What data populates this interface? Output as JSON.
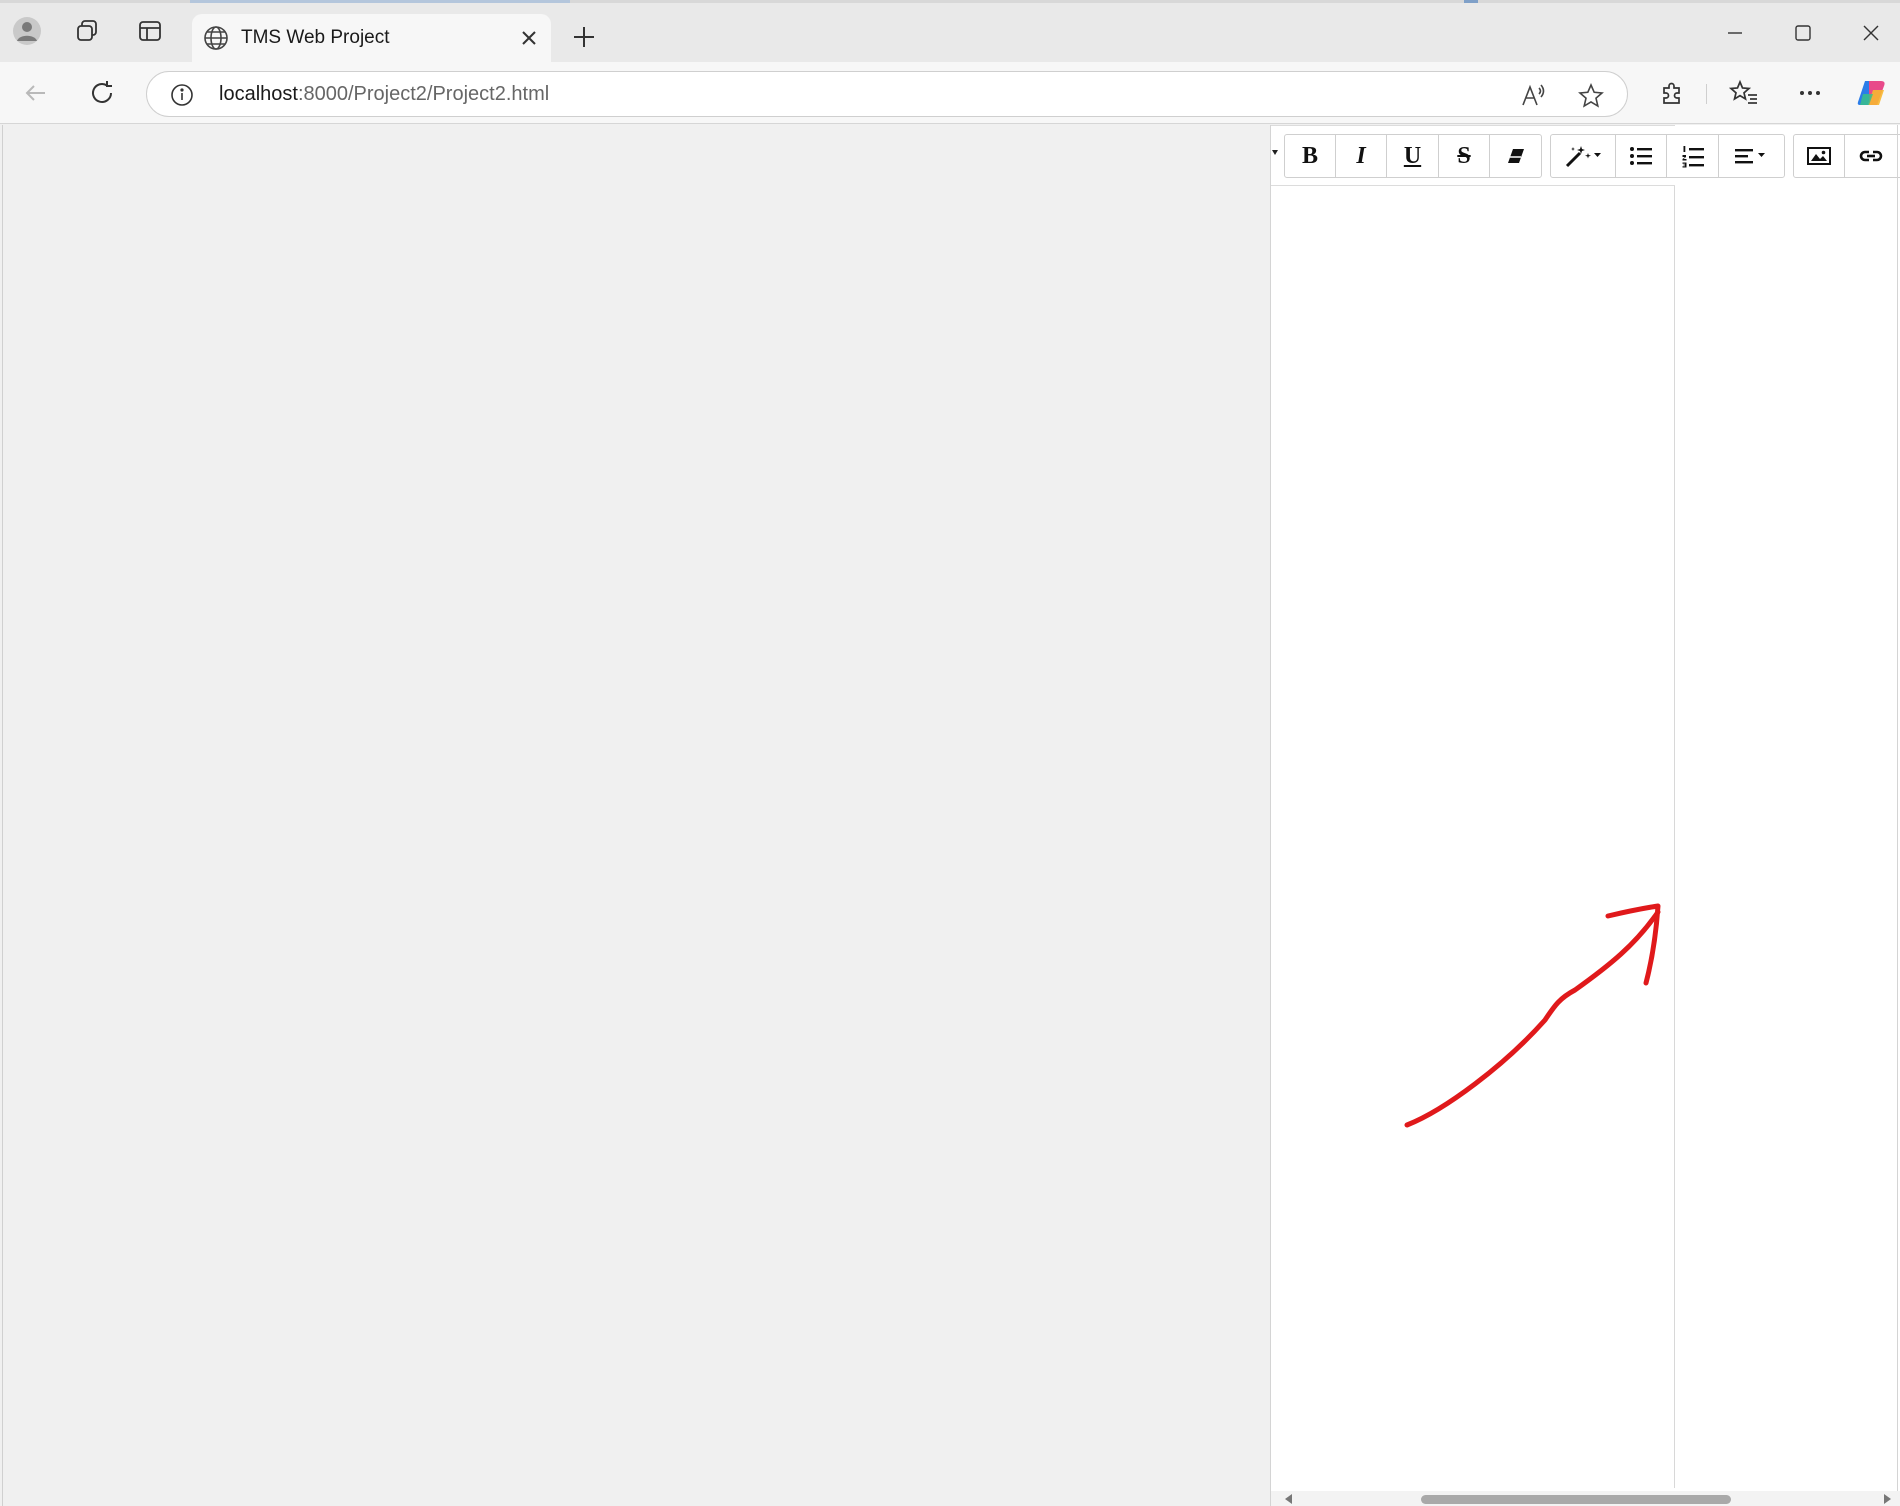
{
  "browser": {
    "tab_title": "TMS Web Project",
    "url_host": "localhost",
    "url_rest": ":8000/Project2/Project2.html",
    "read_aloud_label": "A⁾"
  },
  "toolbar": {
    "bold_label": "B",
    "italic_label": "I",
    "underline_label": "U",
    "strike_label": "S"
  },
  "colors": {
    "annotation_arrow": "#e0191b",
    "accent": "#0b57d0"
  },
  "icons": [
    "profile-icon",
    "workspaces-icon",
    "vertical-tabs-icon",
    "globe-icon",
    "close-icon",
    "plus-icon",
    "minimize-icon",
    "maximize-icon",
    "back-icon",
    "refresh-icon",
    "info-icon",
    "read-aloud-icon",
    "star-icon",
    "extensions-icon",
    "favorites-icon",
    "more-icon",
    "copilot-icon",
    "magic-wand-icon",
    "eraser-icon",
    "bullet-list-icon",
    "numbered-list-icon",
    "align-icon",
    "image-icon",
    "link-icon"
  ]
}
